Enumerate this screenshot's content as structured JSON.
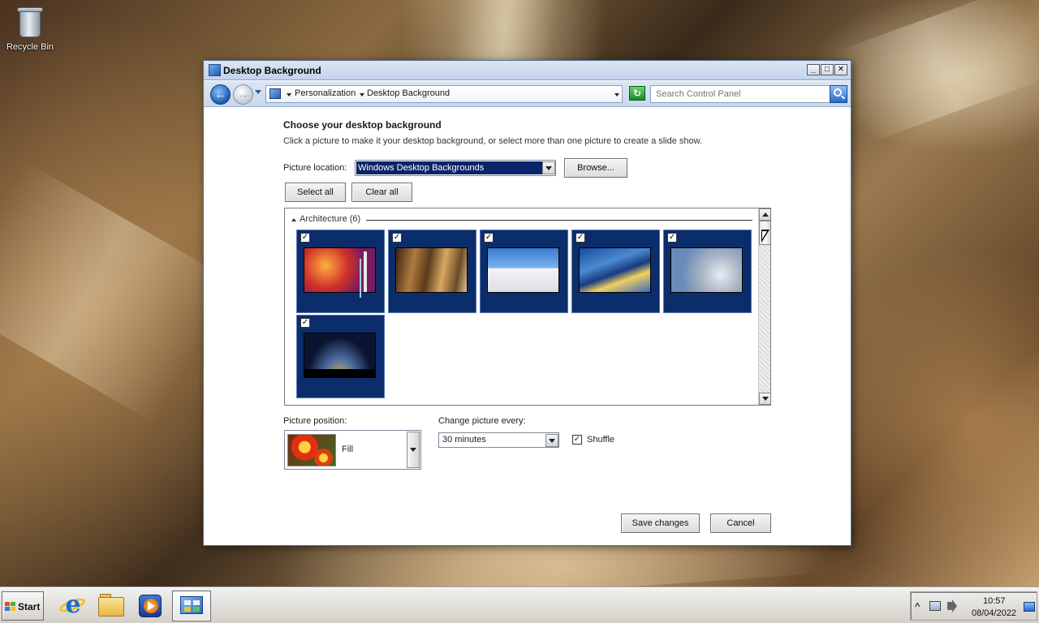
{
  "desktop": {
    "icons": [
      {
        "label": "Recycle Bin",
        "icon": "recycle-bin-icon"
      }
    ]
  },
  "window": {
    "title": "Desktop Background",
    "controls": {
      "minimize": "_",
      "maximize": "□",
      "close": "✕"
    },
    "addressbar": {
      "back_icon": "back-arrow-icon",
      "forward_icon": "forward-arrow-icon",
      "crumbs": [
        "Personalization",
        "Desktop Background"
      ],
      "refresh_icon": "refresh-icon"
    },
    "search": {
      "placeholder": "Search Control Panel"
    }
  },
  "content": {
    "heading": "Choose your desktop background",
    "description": "Click a picture to make it your desktop background, or select more than one picture to create a slide show.",
    "picture_location": {
      "label": "Picture location:",
      "selected": "Windows Desktop Backgrounds"
    },
    "browse_label": "Browse...",
    "select_all_label": "Select all",
    "clear_all_label": "Clear all",
    "gallery": {
      "group": "Architecture (6)",
      "items": [
        {
          "checked": true
        },
        {
          "checked": true
        },
        {
          "checked": true
        },
        {
          "checked": true
        },
        {
          "checked": true
        },
        {
          "checked": true
        }
      ]
    },
    "picture_position": {
      "label": "Picture position:",
      "selected": "Fill"
    },
    "change_picture": {
      "label": "Change picture every:",
      "selected": "30 minutes"
    },
    "shuffle": {
      "label": "Shuffle",
      "checked": true
    },
    "save_label": "Save changes",
    "cancel_label": "Cancel"
  },
  "taskbar": {
    "start_label": "Start",
    "pinned": [
      "internet-explorer-icon",
      "windows-explorer-icon",
      "windows-media-player-icon",
      "control-panel-icon"
    ],
    "tray": {
      "show_hidden": "^",
      "time": "10:57",
      "date": "08/04/2022"
    }
  }
}
